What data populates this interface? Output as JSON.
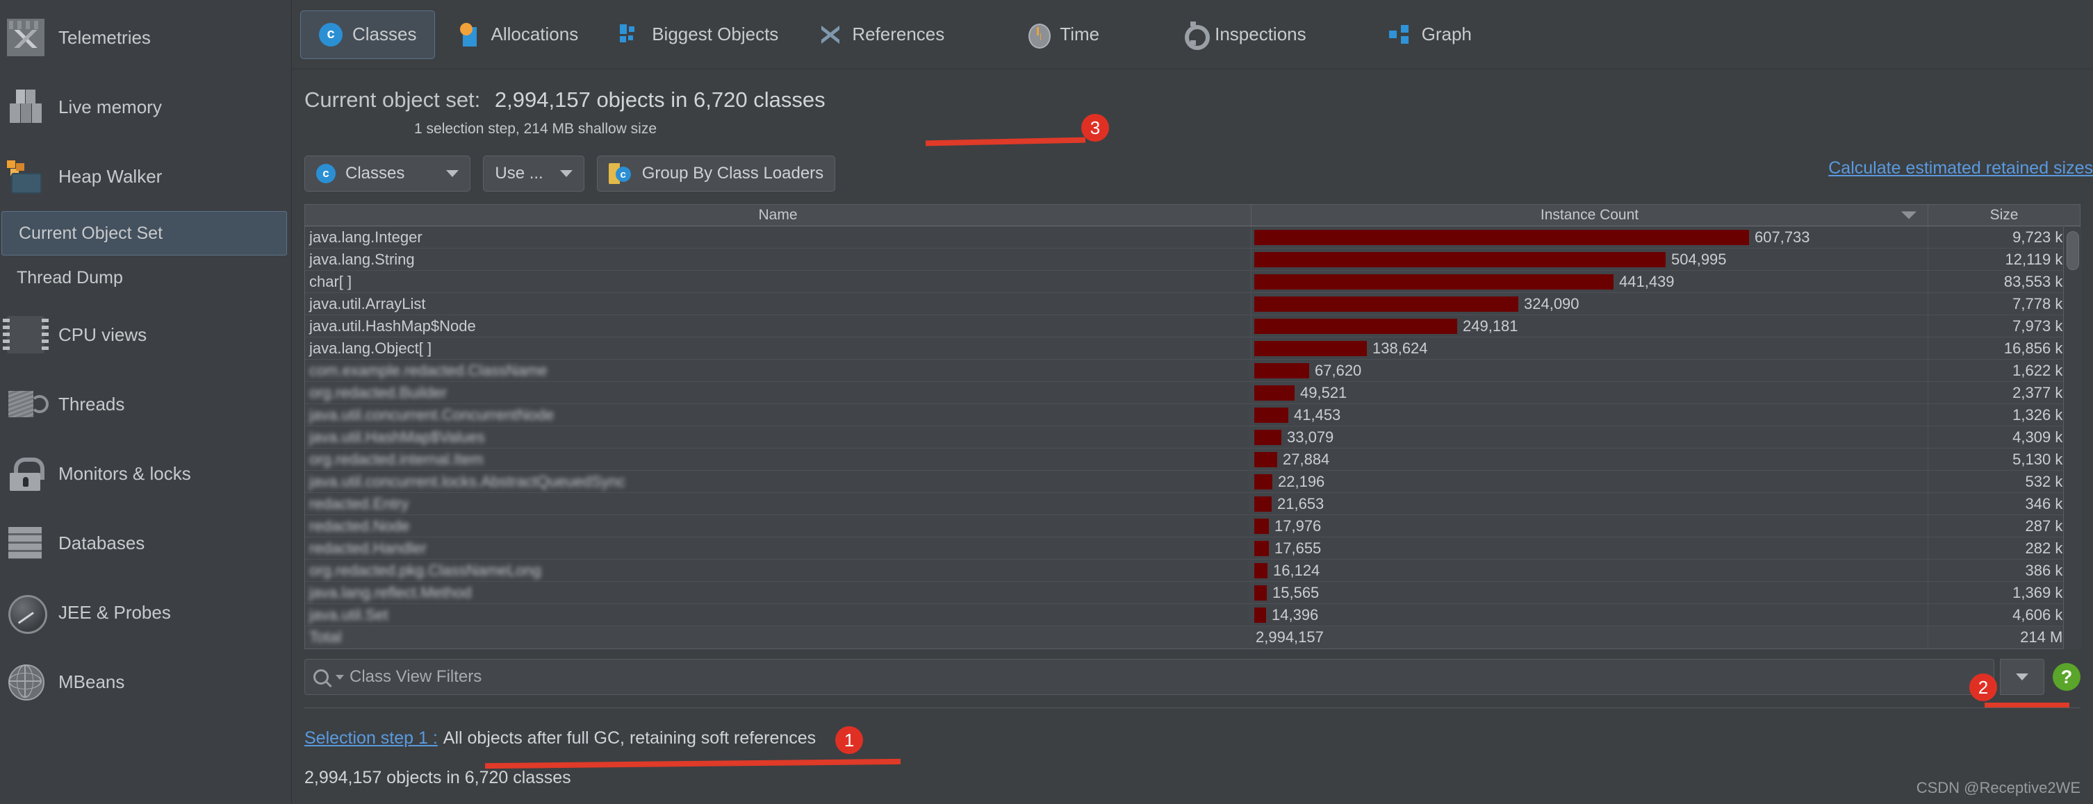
{
  "sidebar": {
    "items": [
      {
        "label": "Telemetries",
        "icon": "telemetry-icon",
        "type": "main",
        "selected": false
      },
      {
        "label": "Live memory",
        "icon": "cubes-icon",
        "type": "main",
        "selected": false
      },
      {
        "label": "Heap Walker",
        "icon": "heap-walker-icon",
        "type": "main",
        "selected": false
      },
      {
        "label": "Current Object Set",
        "icon": "",
        "type": "sub",
        "selected": true
      },
      {
        "label": "Thread Dump",
        "icon": "",
        "type": "sub",
        "selected": false
      },
      {
        "label": "CPU views",
        "icon": "cpu-icon",
        "type": "main",
        "selected": false
      },
      {
        "label": "Threads",
        "icon": "threads-icon",
        "type": "main",
        "selected": false
      },
      {
        "label": "Monitors & locks",
        "icon": "lock-icon",
        "type": "main",
        "selected": false
      },
      {
        "label": "Databases",
        "icon": "database-icon",
        "type": "main",
        "selected": false
      },
      {
        "label": "JEE & Probes",
        "icon": "gauge-icon",
        "type": "main",
        "selected": false
      },
      {
        "label": "MBeans",
        "icon": "globe-icon",
        "type": "main",
        "selected": false
      }
    ]
  },
  "tabs": [
    {
      "label": "Classes",
      "icon": "classes-icon",
      "active": true
    },
    {
      "label": "Allocations",
      "icon": "allocations-icon",
      "active": false
    },
    {
      "label": "Biggest Objects",
      "icon": "biggest-objects-icon",
      "active": false
    },
    {
      "label": "References",
      "icon": "references-icon",
      "active": false
    },
    {
      "label": "Time",
      "icon": "clock-icon",
      "active": false
    },
    {
      "label": "Inspections",
      "icon": "gear-icon",
      "active": false
    },
    {
      "label": "Graph",
      "icon": "graph-icon",
      "active": false
    }
  ],
  "object_set": {
    "label": "Current object set:",
    "summary": "2,994,157 objects in 6,720 classes",
    "detail": "1 selection step, 214 MB shallow size"
  },
  "toolbar": {
    "classes_dropdown": "Classes",
    "use_dropdown": "Use ...",
    "group_by_class_loaders": "Group By Class Loaders",
    "calculate_link": "Calculate estimated retained sizes"
  },
  "table": {
    "columns": [
      "Name",
      "Instance Count",
      "Size"
    ],
    "sorted_column": "Instance Count",
    "sort_direction": "descending",
    "rows": [
      {
        "name": "java.lang.Integer",
        "count": "607,733",
        "count_value": 607733,
        "size": "9,723 kB",
        "blurred": false
      },
      {
        "name": "java.lang.String",
        "count": "504,995",
        "count_value": 504995,
        "size": "12,119 kB",
        "blurred": false
      },
      {
        "name": "char[ ]",
        "count": "441,439",
        "count_value": 441439,
        "size": "83,553 kB",
        "blurred": false
      },
      {
        "name": "java.util.ArrayList",
        "count": "324,090",
        "count_value": 324090,
        "size": "7,778 kB",
        "blurred": false
      },
      {
        "name": "java.util.HashMap$Node",
        "count": "249,181",
        "count_value": 249181,
        "size": "7,973 kB",
        "blurred": false
      },
      {
        "name": "java.lang.Object[ ]",
        "count": "138,624",
        "count_value": 138624,
        "size": "16,856 kB",
        "blurred": false
      },
      {
        "name": "com.example.redacted.ClassName",
        "count": "67,620",
        "count_value": 67620,
        "size": "1,622 kB",
        "blurred": true
      },
      {
        "name": "org.redacted.Builder",
        "count": "49,521",
        "count_value": 49521,
        "size": "2,377 kB",
        "blurred": true
      },
      {
        "name": "java.util.concurrent.ConcurrentNode",
        "count": "41,453",
        "count_value": 41453,
        "size": "1,326 kB",
        "blurred": true
      },
      {
        "name": "java.util.HashMap$Values",
        "count": "33,079",
        "count_value": 33079,
        "size": "4,309 kB",
        "blurred": true
      },
      {
        "name": "org.redacted.internal.Item",
        "count": "27,884",
        "count_value": 27884,
        "size": "5,130 kB",
        "blurred": true
      },
      {
        "name": "java.util.concurrent.locks.AbstractQueuedSync",
        "count": "22,196",
        "count_value": 22196,
        "size": "532 kB",
        "blurred": true
      },
      {
        "name": "redacted.Entry",
        "count": "21,653",
        "count_value": 21653,
        "size": "346 kB",
        "blurred": true
      },
      {
        "name": "redacted.Node",
        "count": "17,976",
        "count_value": 17976,
        "size": "287 kB",
        "blurred": true
      },
      {
        "name": "redacted.Handler",
        "count": "17,655",
        "count_value": 17655,
        "size": "282 kB",
        "blurred": true
      },
      {
        "name": "org.redacted.pkg.ClassNameLong",
        "count": "16,124",
        "count_value": 16124,
        "size": "386 kB",
        "blurred": true
      },
      {
        "name": "java.lang.reflect.Method",
        "count": "15,565",
        "count_value": 15565,
        "size": "1,369 kB",
        "blurred": true
      },
      {
        "name": "java.util.Set",
        "count": "14,396",
        "count_value": 14396,
        "size": "4,606 kB",
        "blurred": true
      }
    ],
    "total_row": {
      "name": "Total",
      "count": "2,994,157",
      "size": "214 MB",
      "blurred": true
    }
  },
  "filter": {
    "placeholder": "Class View Filters",
    "help_label": "?"
  },
  "selection_step": {
    "link": "Selection step 1 :",
    "description": "All objects after full GC, retaining soft references",
    "count": "2,994,157 objects in 6,720 classes"
  },
  "annotations": [
    {
      "id": "1",
      "target": "selection-step-description"
    },
    {
      "id": "2",
      "target": "total-size-cell"
    },
    {
      "id": "3",
      "target": "shallow-size-detail"
    }
  ],
  "watermark": "CSDN @Receptive2WE",
  "colors": {
    "background": "#3c4043",
    "bar": "#6b0000",
    "link": "#5a9ae0",
    "accent_blue": "#2b8fd4",
    "annotation_red": "#e03024",
    "selected_nav": "#44515e"
  }
}
